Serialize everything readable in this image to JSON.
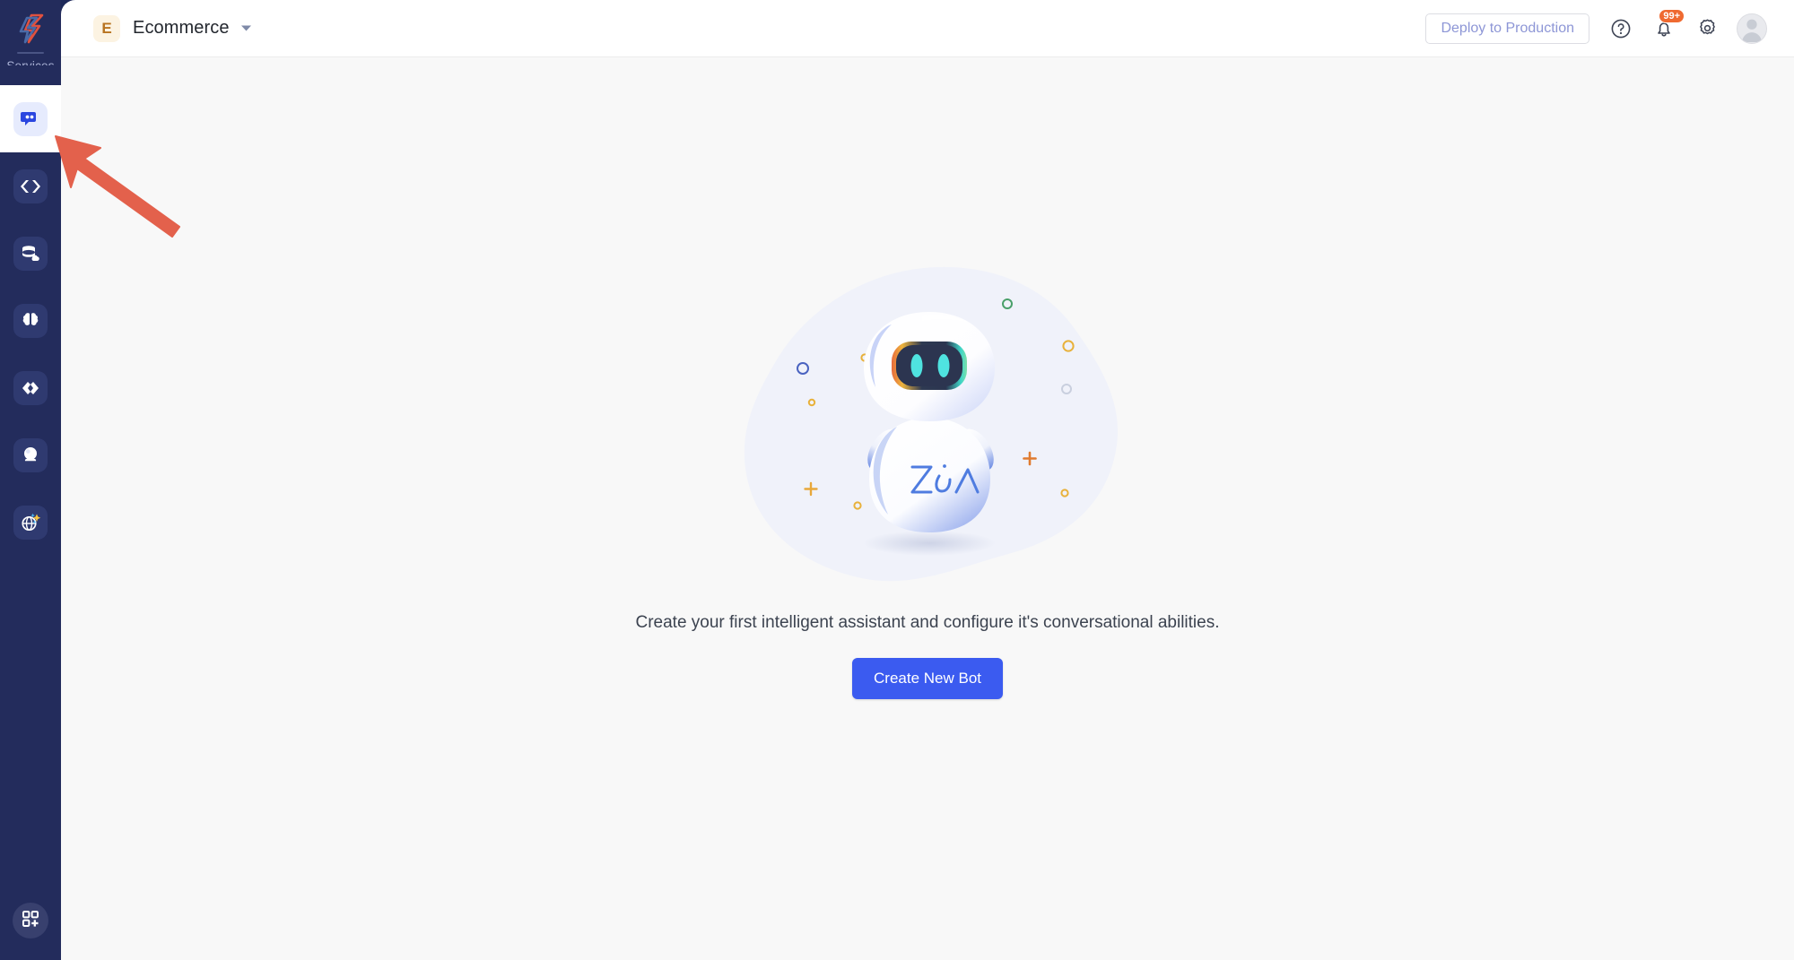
{
  "app": {
    "logo_icon": "zoho-catalyst-logo-icon",
    "background_color": "#f8f8f8",
    "rail_color": "#232c5c",
    "accent_color": "#3b5bf0",
    "badge_color": "#ef6a31"
  },
  "sidebar": {
    "section_label": "Services",
    "items": [
      {
        "label": "Chat Bots",
        "icon": "chat-bubbles-icon",
        "active": true
      },
      {
        "label": "Functions",
        "icon": "code-brackets-icon",
        "active": false
      },
      {
        "label": "Data Store",
        "icon": "database-cloud-icon",
        "active": false
      },
      {
        "label": "AI",
        "icon": "brain-icon",
        "active": false
      },
      {
        "label": "Integrations",
        "icon": "infinity-link-icon",
        "active": false
      },
      {
        "label": "Crystal Ball",
        "icon": "crystal-ball-icon",
        "active": false
      },
      {
        "label": "Smart Browser",
        "icon": "globe-sparkle-icon",
        "active": false
      }
    ],
    "bottom_item": {
      "label": "All Services",
      "icon": "grid-plus-icon"
    }
  },
  "header": {
    "workspace_initial": "E",
    "workspace_name": "Ecommerce",
    "workspace_caret_icon": "chevron-down-icon",
    "deploy_label": "Deploy to Production",
    "help_icon": "question-circle-icon",
    "notifications_icon": "bell-icon",
    "notifications_count": "99+",
    "settings_icon": "gear-icon",
    "avatar_icon": "user-avatar-icon"
  },
  "main": {
    "illustration": "zia-robot-mascot",
    "robot_label": "zia",
    "empty_state_text": "Create your first intelligent assistant and configure it's conversational abilities.",
    "cta_label": "Create New Bot"
  },
  "annotation": {
    "arrow_color": "#e3614c",
    "arrow_points_to": "sidebar-item-chat-bots"
  }
}
